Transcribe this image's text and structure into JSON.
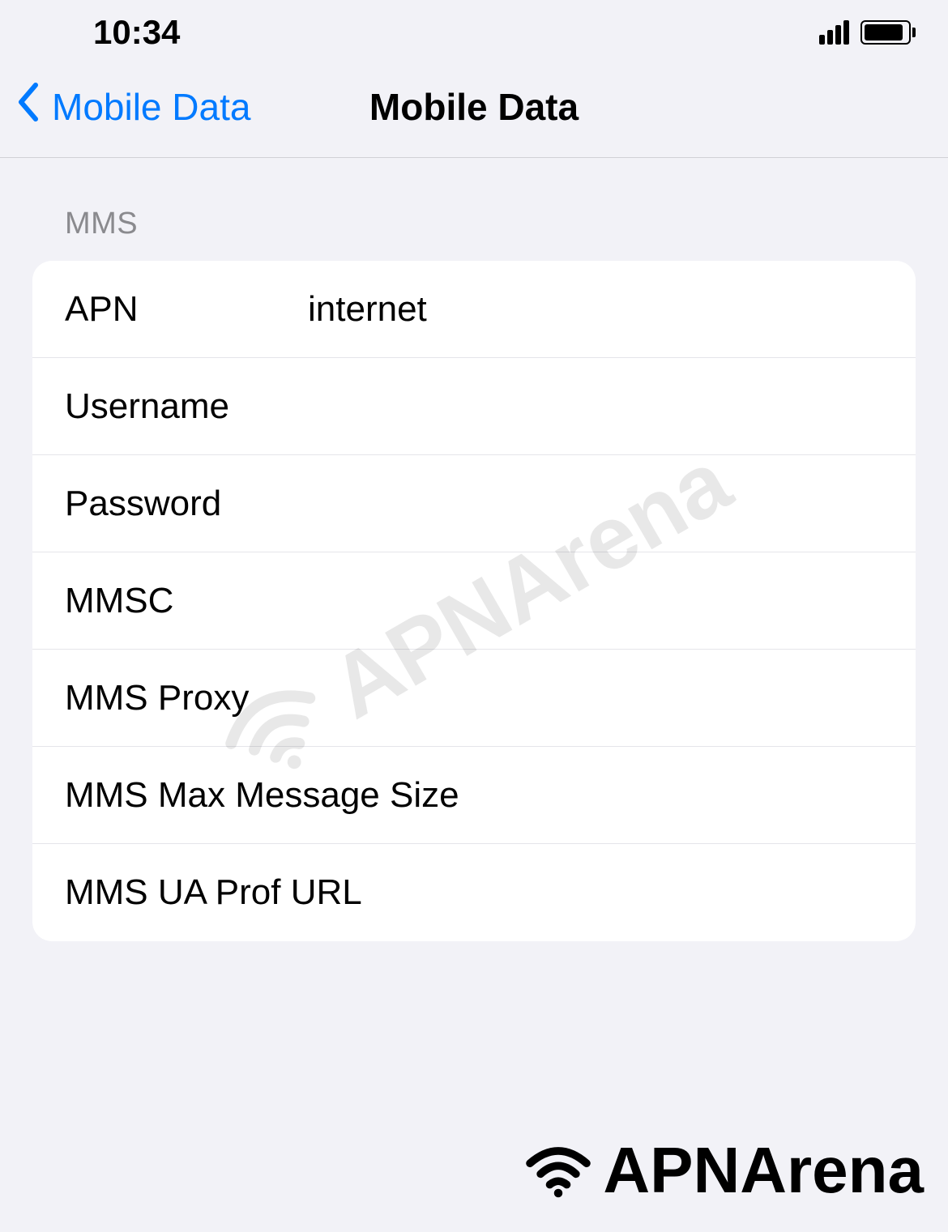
{
  "status_bar": {
    "time": "10:34"
  },
  "nav": {
    "back_label": "Mobile Data",
    "title": "Mobile Data"
  },
  "section": {
    "header": "MMS",
    "rows": [
      {
        "label": "APN",
        "value": "internet"
      },
      {
        "label": "Username",
        "value": ""
      },
      {
        "label": "Password",
        "value": ""
      },
      {
        "label": "MMSC",
        "value": ""
      },
      {
        "label": "MMS Proxy",
        "value": ""
      },
      {
        "label": "MMS Max Message Size",
        "value": ""
      },
      {
        "label": "MMS UA Prof URL",
        "value": ""
      }
    ]
  },
  "watermark": {
    "center": "APNArena",
    "bottom": "APNArena"
  }
}
